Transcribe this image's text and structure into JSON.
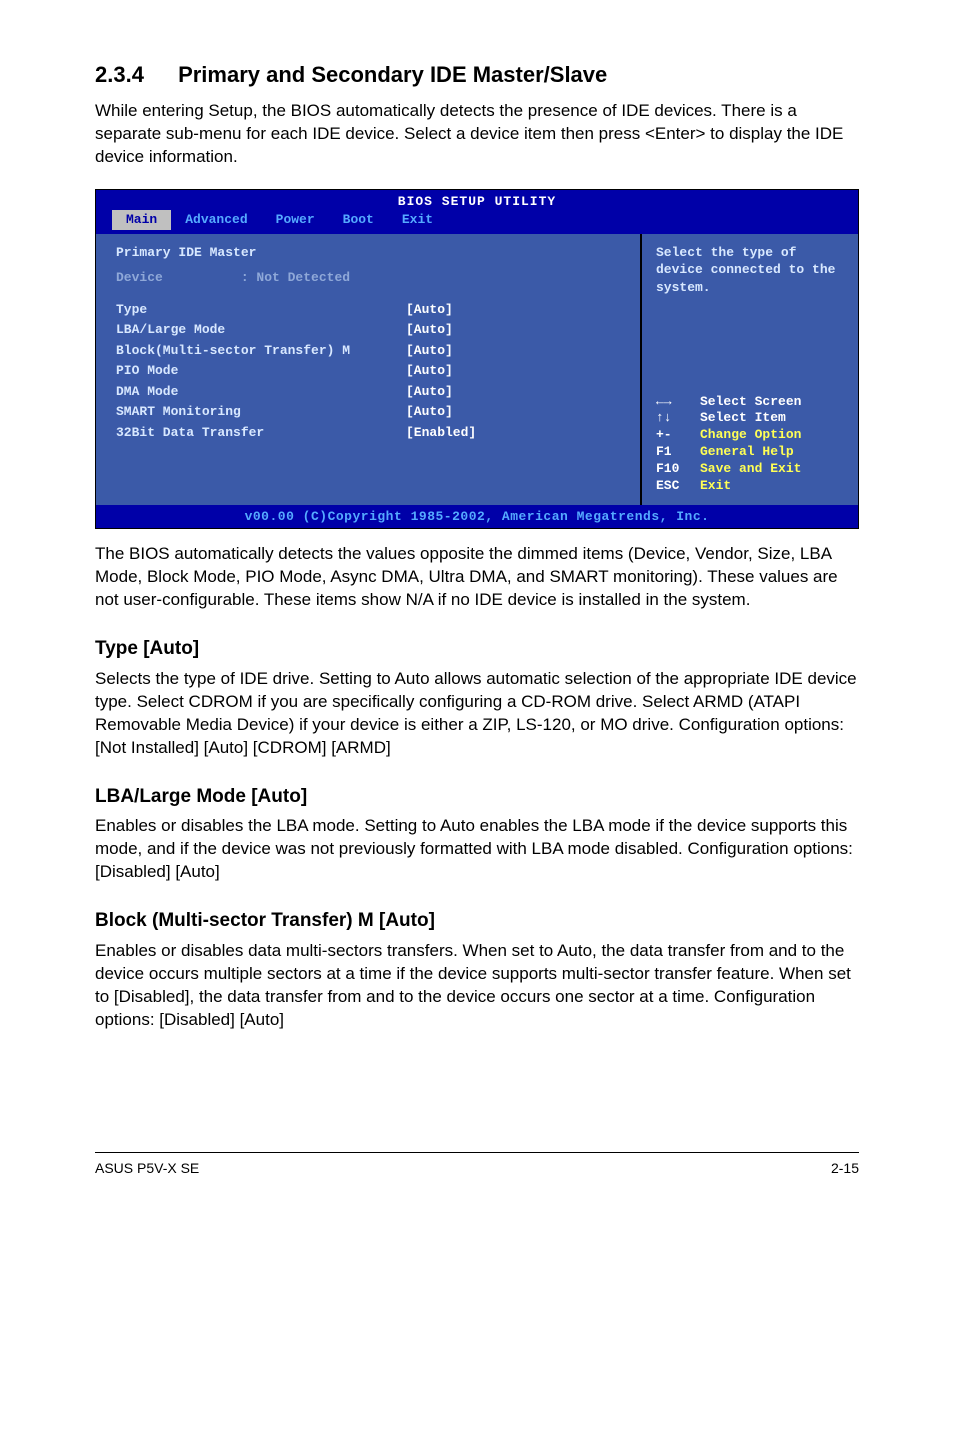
{
  "section": {
    "number": "2.3.4",
    "title": "Primary and Secondary IDE Master/Slave",
    "intro": "While entering Setup, the BIOS automatically detects the presence of IDE devices. There is a separate sub-menu for each IDE device. Select a device item then press <Enter> to display the IDE device information."
  },
  "bios": {
    "title": "BIOS SETUP UTILITY",
    "tabs": [
      "Main",
      "Advanced",
      "Power",
      "Boot",
      "Exit"
    ],
    "active_tab": "Main",
    "heading": "Primary IDE Master",
    "device_label": "Device",
    "device_value": ": Not Detected",
    "rows": [
      {
        "label": "Type",
        "value": "[Auto]"
      },
      {
        "label": "LBA/Large Mode",
        "value": "[Auto]"
      },
      {
        "label": "Block(Multi-sector Transfer) M",
        "value": "[Auto]"
      },
      {
        "label": "PIO Mode",
        "value": "[Auto]"
      },
      {
        "label": "DMA Mode",
        "value": "[Auto]"
      },
      {
        "label": "SMART Monitoring",
        "value": "[Auto]"
      },
      {
        "label": "32Bit Data Transfer",
        "value": "[Enabled]"
      }
    ],
    "help_text": "Select the type of device connected to the system.",
    "keys": [
      {
        "k": "←→",
        "d": "Select Screen",
        "white": true
      },
      {
        "k": "↑↓",
        "d": "Select Item",
        "white": true
      },
      {
        "k": "+-",
        "d": "Change Option"
      },
      {
        "k": "F1",
        "d": "General Help"
      },
      {
        "k": "F10",
        "d": "Save and Exit"
      },
      {
        "k": "ESC",
        "d": "Exit"
      }
    ],
    "footer": "v00.00 (C)Copyright 1985-2002, American Megatrends, Inc."
  },
  "post_bios": "The BIOS automatically detects the values opposite the dimmed items (Device, Vendor, Size, LBA Mode, Block Mode, PIO Mode, Async DMA, Ultra DMA, and SMART monitoring). These values are not user-configurable. These items show N/A if no IDE device is installed in the system.",
  "subsections": [
    {
      "heading": "Type [Auto]",
      "body": "Selects the type of IDE drive. Setting to Auto allows automatic selection of the appropriate IDE device type. Select CDROM if you are specifically configuring a CD-ROM drive. Select ARMD (ATAPI Removable Media Device) if your device is either a ZIP, LS-120, or MO drive. Configuration options: [Not Installed] [Auto] [CDROM] [ARMD]"
    },
    {
      "heading": "LBA/Large Mode [Auto]",
      "body": "Enables or disables the LBA mode. Setting to Auto enables the LBA mode if the device supports this mode, and if the device was not previously formatted with LBA mode disabled. Configuration options: [Disabled] [Auto]"
    },
    {
      "heading": "Block (Multi-sector Transfer) M [Auto]",
      "body": "Enables or disables data multi-sectors transfers. When set to Auto, the data transfer from and to the device occurs multiple sectors at a time if the device supports multi-sector transfer feature. When set to [Disabled], the data transfer from and to the device occurs one sector at a time. Configuration options: [Disabled] [Auto]"
    }
  ],
  "footer": {
    "left": "ASUS P5V-X SE",
    "right": "2-15"
  }
}
